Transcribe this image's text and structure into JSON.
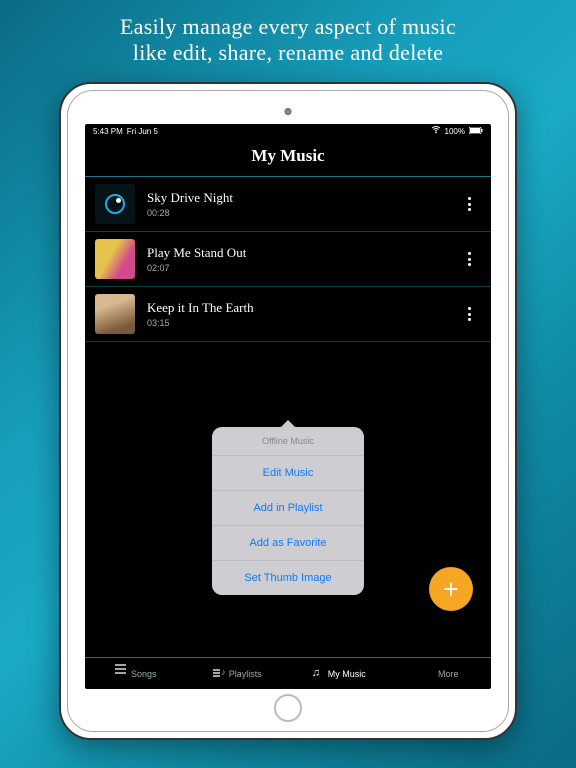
{
  "marketing": {
    "line1": "Easily manage every aspect of music",
    "line2": "like edit, share, rename and delete"
  },
  "statusbar": {
    "time": "5:43 PM",
    "date": "Fri Jun 5",
    "battery": "100%"
  },
  "header": {
    "title": "My Music"
  },
  "songs": [
    {
      "title": "Sky Drive Night",
      "duration": "00:28",
      "thumb": "music"
    },
    {
      "title": "Play Me Stand Out",
      "duration": "02:07",
      "thumb": "photo1"
    },
    {
      "title": "Keep it In The Earth",
      "duration": "03:15",
      "thumb": "photo2"
    }
  ],
  "popover": {
    "heading": "Offline Music",
    "items": [
      "Edit Music",
      "Add in Playlist",
      "Add as Favorite",
      "Set Thumb Image"
    ]
  },
  "fab": {
    "glyph": "+"
  },
  "tabs": [
    {
      "label": "Songs",
      "active": false
    },
    {
      "label": "Playlists",
      "active": false
    },
    {
      "label": "My Music",
      "active": true
    },
    {
      "label": "More",
      "active": false
    }
  ]
}
